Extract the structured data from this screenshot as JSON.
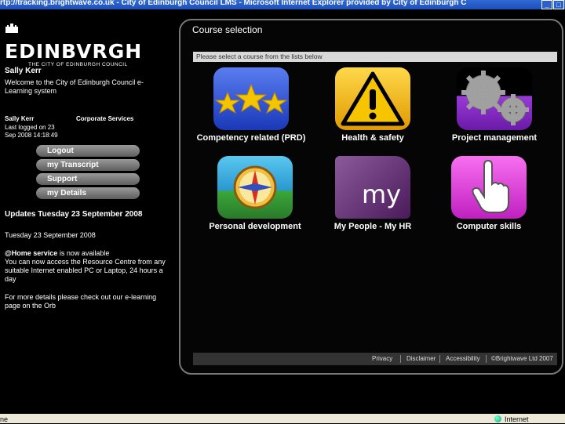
{
  "browser": {
    "title": "rtp://tracking.brightwave.co.uk - City of Edinburgh Council LMS - Microsoft Internet Explorer provided by City of Edinburgh C",
    "status_left": "ne",
    "zone": "Internet"
  },
  "logo": {
    "word": "EDINBVRGH",
    "sub": "THE CITY OF EDINBURGH COUNCIL"
  },
  "user": {
    "name": "Sally Kerr",
    "welcome": "Welcome to the City of Edinburgh Council e-Learning system",
    "name_small": "Sally Kerr",
    "department": "Corporate Services",
    "last_logged": "Last logged on 23 Sep 2008 14:18:49"
  },
  "menu": [
    {
      "label": "Logout"
    },
    {
      "label": "my Transcript"
    },
    {
      "label": "Support"
    },
    {
      "label": "my Details"
    }
  ],
  "updates": {
    "title": "Updates Tuesday 23 September 2008",
    "date": "Tuesday 23 September 2008",
    "service_name": "@Home service",
    "service_text": " is now available",
    "body": "You can now access the Resource Centre from any suitable Internet enabled PC or Laptop, 24 hours a day",
    "more": "For more details please check out our e-learning page on the Orb"
  },
  "course_panel": {
    "title": "Course selection",
    "instruction": "Please select a course from the lists below",
    "courses": [
      {
        "label": "Competency related (PRD)",
        "icon": "stars-icon",
        "color": "#2a4fd8"
      },
      {
        "label": "Health & safety",
        "icon": "warning-icon",
        "color": "#f2b400"
      },
      {
        "label": "Project management",
        "icon": "gears-icon",
        "color": "#8a2fc8"
      },
      {
        "label": "Personal development",
        "icon": "compass-icon",
        "color": "#2aa8d8"
      },
      {
        "label": "My People -  My HR",
        "icon": "my-icon",
        "icon_text": "my",
        "color": "#6a3a7a"
      },
      {
        "label": "Computer skills",
        "icon": "hand-pointer-icon",
        "color": "#e03ad8"
      }
    ],
    "footer": {
      "privacy": "Privacy",
      "disclaimer": "Disclaimer",
      "accessibility": "Accessibility",
      "copyright": "©Brightwave Ltd 2007"
    }
  }
}
